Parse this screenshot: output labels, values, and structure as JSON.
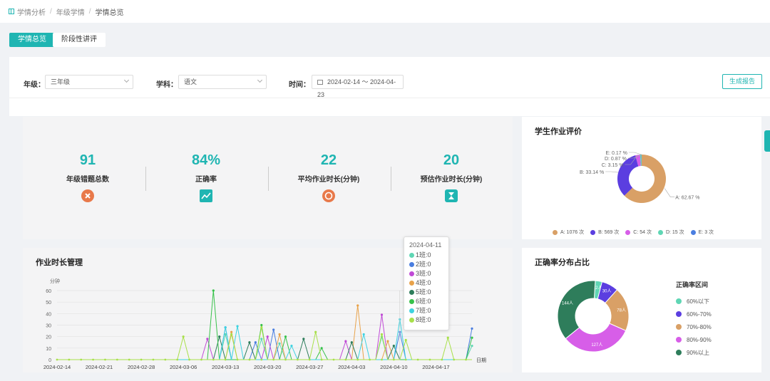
{
  "breadcrumb": {
    "items": [
      "学情分析",
      "年级学情",
      "学情总览"
    ]
  },
  "tabs": [
    {
      "label": "学情总览",
      "active": true
    },
    {
      "label": "阶段性讲评",
      "active": false
    }
  ],
  "filters": {
    "grade_label": "年级：",
    "grade_value": "三年级",
    "subject_label": "学科：",
    "subject_value": "语文",
    "time_label": "时间：",
    "time_value": "2024-02-14 ～ 2024-04-23"
  },
  "generate_button": "生成报告",
  "stats": [
    {
      "value": "91",
      "label": "年级错题总数",
      "icon": "error-cross-icon",
      "color": "#e8794a"
    },
    {
      "value": "84%",
      "label": "正确率",
      "icon": "trend-chart-icon",
      "color": "#1fb5b2"
    },
    {
      "value": "22",
      "label": "平均作业时长(分钟)",
      "icon": "timer-icon",
      "color": "#e8794a"
    },
    {
      "value": "20",
      "label": "预估作业时长(分钟)",
      "icon": "hourglass-icon",
      "color": "#1fb5b2"
    }
  ],
  "eval_card": {
    "title": "学生作业评价"
  },
  "homework_card": {
    "title": "作业时长管理",
    "y_unit": "分钟",
    "x_unit": "日期"
  },
  "accuracy_card": {
    "title": "正确率分布占比"
  },
  "chart_data": [
    {
      "type": "pie",
      "title": "学生作业评价",
      "style": "donut",
      "legend_position": "bottom",
      "slices": [
        {
          "name": "A",
          "count_label": "A: 1076 次",
          "pct_label": "A: 62.67 %",
          "value": 62.67,
          "color": "#d9a066"
        },
        {
          "name": "B",
          "count_label": "B: 569 次",
          "pct_label": "B: 33.14 %",
          "value": 33.14,
          "color": "#5b3ee0"
        },
        {
          "name": "C",
          "count_label": "C: 54 次",
          "pct_label": "C: 3.15 %",
          "value": 3.15,
          "color": "#d75ee8"
        },
        {
          "name": "D",
          "count_label": "D: 15 次",
          "pct_label": "D: 0.87 %",
          "value": 0.87,
          "color": "#5fd6b4"
        },
        {
          "name": "E",
          "count_label": "E: 3 次",
          "pct_label": "E: 0.17 %",
          "value": 0.17,
          "color": "#4a7ee0"
        }
      ]
    },
    {
      "type": "line",
      "title": "作业时长管理",
      "ylabel": "分钟",
      "xlabel": "日期",
      "ylim": [
        0,
        60
      ],
      "yticks": [
        0,
        10,
        20,
        30,
        40,
        50,
        60
      ],
      "x_tick_labels": [
        "2024-02-14",
        "2024-02-21",
        "2024-02-28",
        "2024-03-06",
        "2024-03-13",
        "2024-03-20",
        "2024-03-27",
        "2024-04-03",
        "2024-04-10",
        "2024-04-17"
      ],
      "x_start": "2024-02-14",
      "x_end": "2024-04-23",
      "series": [
        {
          "name": "1班",
          "color": "#5fd6b4",
          "points": [
            [
              "2024-03-13",
              22
            ],
            [
              "2024-03-19",
              18
            ],
            [
              "2024-03-22",
              14
            ],
            [
              "2024-04-08",
              20
            ],
            [
              "2024-04-23",
              12
            ]
          ]
        },
        {
          "name": "2班",
          "color": "#4a7ee0",
          "points": [
            [
              "2024-03-13",
              28
            ],
            [
              "2024-03-18",
              15
            ],
            [
              "2024-03-21",
              26
            ],
            [
              "2024-04-11",
              24
            ],
            [
              "2024-04-23",
              27
            ]
          ]
        },
        {
          "name": "3班",
          "color": "#c04ad6",
          "points": [
            [
              "2024-03-10",
              18
            ],
            [
              "2024-03-20",
              20
            ],
            [
              "2024-04-02",
              16
            ],
            [
              "2024-04-08",
              39
            ]
          ]
        },
        {
          "name": "4班",
          "color": "#e8a24a",
          "points": [
            [
              "2024-03-14",
              24
            ],
            [
              "2024-03-22",
              22
            ],
            [
              "2024-04-04",
              47
            ],
            [
              "2024-04-09",
              16
            ]
          ]
        },
        {
          "name": "5班",
          "color": "#2e7d5b",
          "points": [
            [
              "2024-03-12",
              20
            ],
            [
              "2024-03-17",
              15
            ],
            [
              "2024-03-26",
              18
            ],
            [
              "2024-04-03",
              15
            ],
            [
              "2024-04-10",
              12
            ]
          ]
        },
        {
          "name": "6班",
          "color": "#37c24a",
          "points": [
            [
              "2024-03-11",
              60
            ],
            [
              "2024-03-19",
              30
            ],
            [
              "2024-03-23",
              20
            ],
            [
              "2024-03-29",
              10
            ],
            [
              "2024-04-23",
              19
            ]
          ]
        },
        {
          "name": "7班",
          "color": "#3fd3e0",
          "points": [
            [
              "2024-03-13",
              28
            ],
            [
              "2024-03-15",
              29
            ],
            [
              "2024-03-24",
              12
            ],
            [
              "2024-04-05",
              22
            ],
            [
              "2024-04-11",
              35
            ]
          ]
        },
        {
          "name": "8班",
          "color": "#a8e04a",
          "points": [
            [
              "2024-03-06",
              20
            ],
            [
              "2024-03-14",
              22
            ],
            [
              "2024-03-19",
              28
            ],
            [
              "2024-03-28",
              24
            ],
            [
              "2024-04-08",
              22
            ],
            [
              "2024-04-12",
              17
            ],
            [
              "2024-04-19",
              19
            ]
          ]
        }
      ],
      "tooltip": {
        "date": "2024-04-11",
        "rows": [
          "1班:0",
          "2班:0",
          "3班:0",
          "4班:0",
          "5班:0",
          "6班:0",
          "7班:0",
          "8班:0"
        ]
      }
    },
    {
      "type": "pie",
      "title": "正确率分布占比",
      "style": "donut",
      "legend_title": "正确率区间",
      "legend_position": "right",
      "slices": [
        {
          "name": "60%以下",
          "value": 12,
          "label": "12人",
          "color": "#5fd6b4"
        },
        {
          "name": "60%-70%",
          "value": 30,
          "label": "30人",
          "color": "#5b3ee0"
        },
        {
          "name": "70%-80%",
          "value": 78,
          "label": "78人",
          "color": "#d9a066"
        },
        {
          "name": "80%-90%",
          "value": 127,
          "label": "127人",
          "color": "#d75ee8"
        },
        {
          "name": "90%以上",
          "value": 144,
          "label": "144人",
          "color": "#2e7d5b"
        }
      ]
    }
  ]
}
